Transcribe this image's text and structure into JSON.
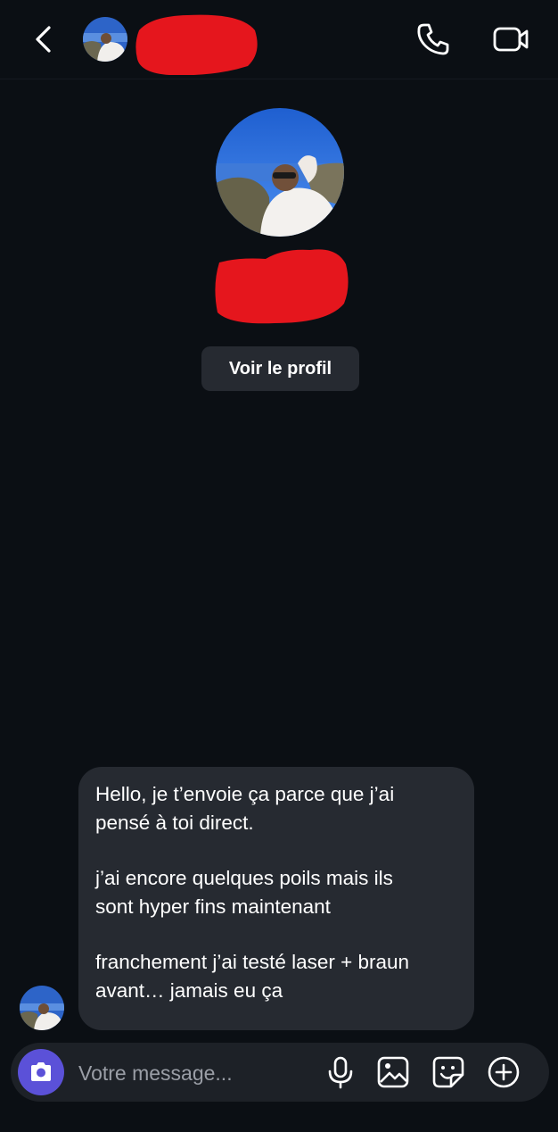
{
  "header": {
    "back_icon": "chevron-left-icon",
    "call_icon": "phone-icon",
    "video_icon": "video-camera-icon"
  },
  "profile": {
    "view_profile_label": "Voir le profil"
  },
  "conversation": {
    "messages": [
      {
        "paragraphs": [
          "Hello, je t’envoie ça parce que j’ai\npensé à toi direct.",
          "j’ai encore quelques poils mais ils\nsont hyper fins maintenant",
          "franchement j’ai testé laser + braun\navant… jamais eu ça"
        ]
      }
    ]
  },
  "composer": {
    "placeholder": "Votre message...",
    "icons": [
      "camera-icon",
      "microphone-icon",
      "gallery-icon",
      "sticker-icon",
      "plus-circle-icon"
    ]
  },
  "colors": {
    "background": "#0b0f14",
    "bubble": "#262a31",
    "composer": "#1d2127",
    "accent": "#5b51d8",
    "redaction": "#e5161d"
  }
}
